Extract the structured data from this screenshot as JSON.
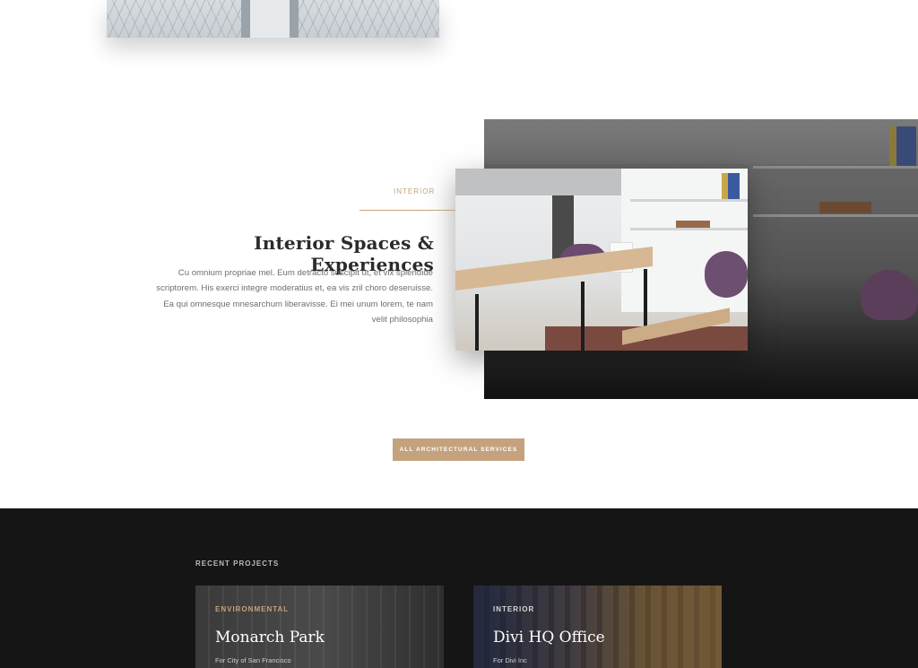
{
  "interior_section": {
    "tag": "INTERIOR",
    "title": "Interior Spaces & Experiences",
    "body_lines": [
      "Cu omnium propriae mel. Eum detracto suscipit ut, et vix splendide",
      "scriptorem. His exerci integre moderatius et, ea vis zril choro deseruisse.",
      "Ea qui omnesque mnesarchum liberavisse. Ei mei unum lorem, te nam",
      "velit philosophia"
    ]
  },
  "cta": {
    "label": "ALL ARCHITECTURAL SERVICES"
  },
  "recent_projects": {
    "label": "RECENT PROJECTS",
    "cards": [
      {
        "category": "ENVIRONMENTAL",
        "name": "Monarch Park",
        "client": "For City of San Francisco"
      },
      {
        "category": "INTERIOR",
        "name": "Divi HQ Office",
        "client": "For Divi Inc"
      }
    ]
  },
  "colors": {
    "accent": "#c4a27e",
    "dark_bg": "#151515",
    "text": "#2b2b2b"
  }
}
